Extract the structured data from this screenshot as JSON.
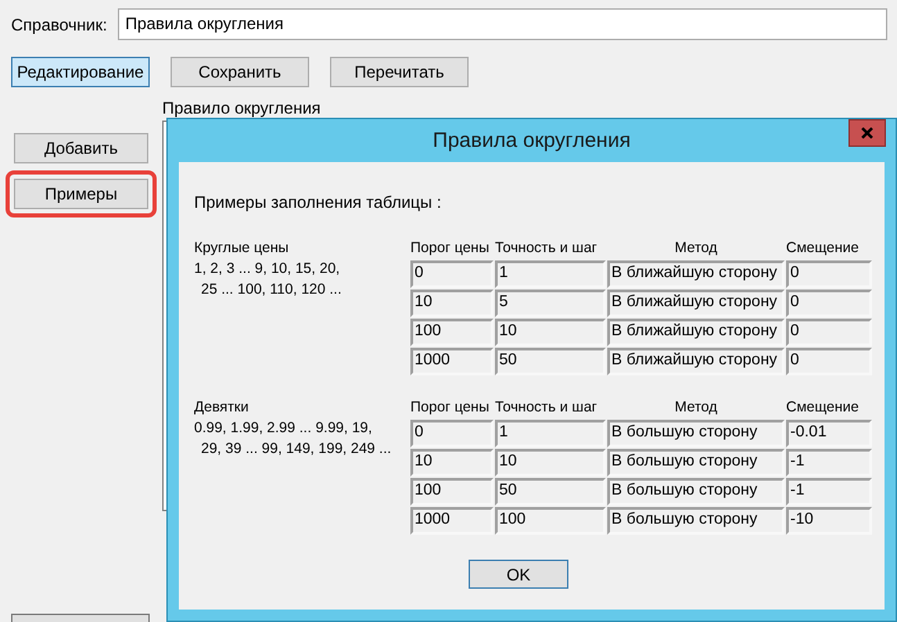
{
  "app": {
    "directory_label": "Справочник:",
    "directory_value": "Правила округления",
    "toolbar": [
      {
        "label": "Редактирование",
        "selected": true
      },
      {
        "label": "Сохранить",
        "selected": false
      },
      {
        "label": "Перечитать",
        "selected": false
      }
    ],
    "rule_label": "Правило округления",
    "side_buttons": [
      {
        "label": "Добавить",
        "highlighted": false
      },
      {
        "label": "Примеры",
        "highlighted": true
      }
    ]
  },
  "dialog": {
    "title": "Правила округления",
    "intro": "Примеры заполнения таблицы :",
    "sections": [
      {
        "title": "Круглые цены",
        "lines": [
          "1, 2, 3 ... 9, 10, 15, 20,",
          "25 ... 100, 110, 120 ..."
        ],
        "columns": [
          "Порог цены",
          "Точность и шаг",
          "Метод",
          "Смещение"
        ],
        "rows": [
          [
            "0",
            "1",
            "В ближайшую сторону",
            "0"
          ],
          [
            "10",
            "5",
            "В ближайшую сторону",
            "0"
          ],
          [
            "100",
            "10",
            "В ближайшую сторону",
            "0"
          ],
          [
            "1000",
            "50",
            "В ближайшую сторону",
            "0"
          ]
        ]
      },
      {
        "title": "Девятки",
        "lines": [
          "0.99, 1.99, 2.99 ... 9.99, 19,",
          "29, 39 ... 99, 149, 199, 249 ..."
        ],
        "columns": [
          "Порог цены",
          "Точность и шаг",
          "Метод",
          "Смещение"
        ],
        "rows": [
          [
            "0",
            "1",
            "В большую сторону",
            "-0.01"
          ],
          [
            "10",
            "10",
            "В большую сторону",
            "-1"
          ],
          [
            "100",
            "50",
            "В большую сторону",
            "-1"
          ],
          [
            "1000",
            "100",
            "В большую сторону",
            "-10"
          ]
        ]
      }
    ],
    "ok": "OK"
  }
}
